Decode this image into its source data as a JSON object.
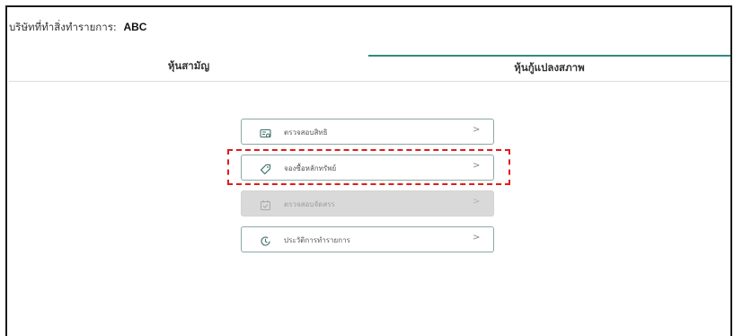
{
  "header": {
    "company_label": "บริษัทที่ทำสิ่งทำรายการ:",
    "company_value": "ABC"
  },
  "tabs": [
    {
      "label": "หุ้นสามัญ",
      "active": false
    },
    {
      "label": "หุ้นกู้แปลงสภาพ",
      "active": true
    }
  ],
  "menu": {
    "items": [
      {
        "label": "ตรวจสอบสิทธิ",
        "icon": "id-card-icon",
        "enabled": true
      },
      {
        "label": "จองซื้อหลักทรัพย์",
        "icon": "tag-icon",
        "enabled": true,
        "highlighted": true
      },
      {
        "label": "ตรวจสอบจัดสรร",
        "icon": "calendar-check-icon",
        "enabled": false
      },
      {
        "label": "ประวัติการทำรายการ",
        "icon": "history-clock-icon",
        "enabled": true
      }
    ],
    "chevron": ">"
  },
  "colors": {
    "accent": "#2f8a80",
    "item_border": "#8da8a6",
    "disabled_bg": "#d9d9d9",
    "highlight": "#e01b1b"
  }
}
